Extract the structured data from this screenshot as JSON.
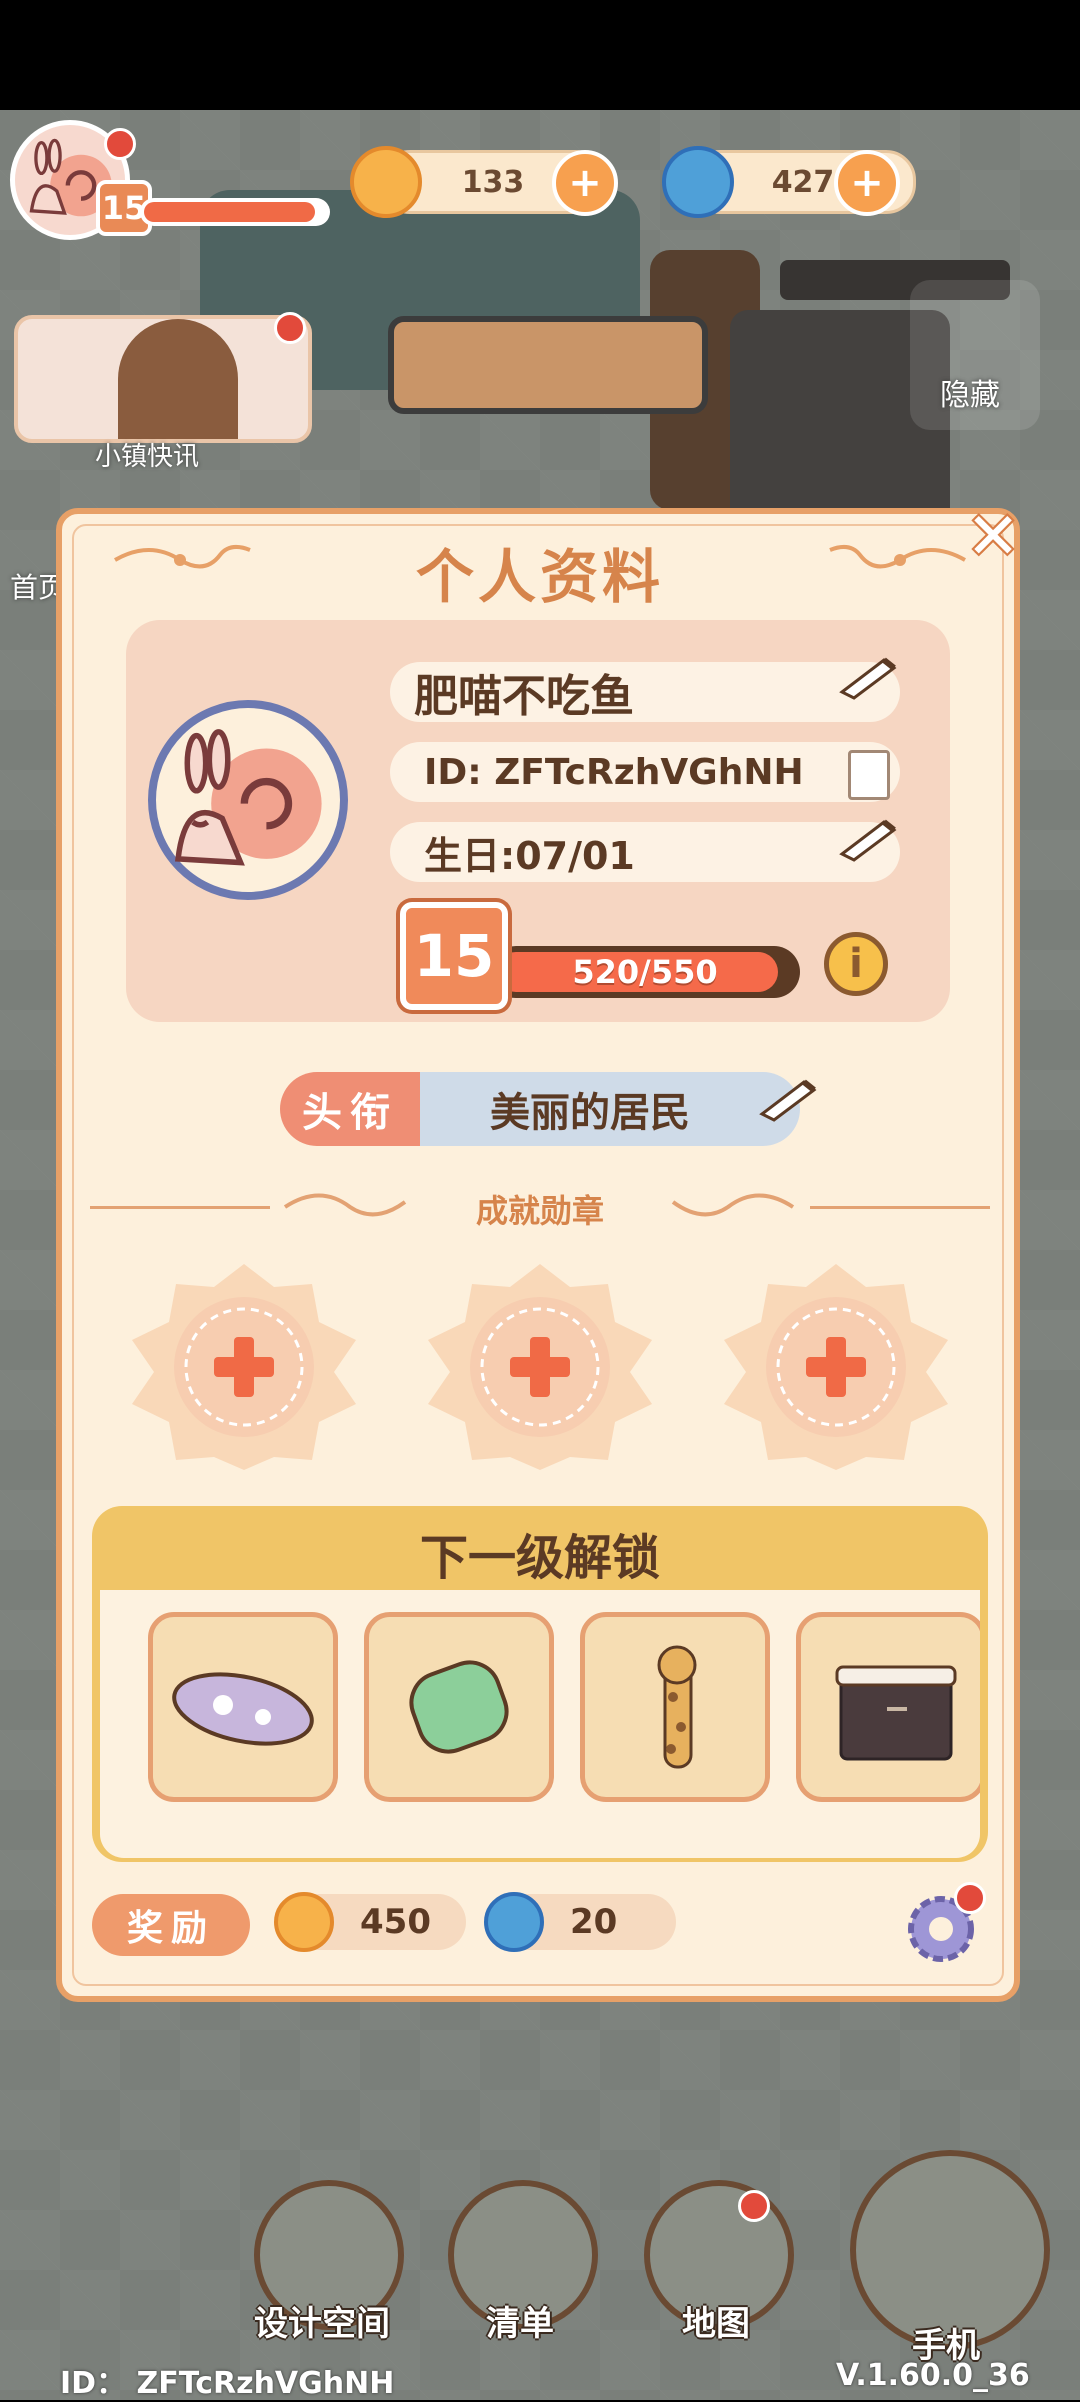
{
  "hud": {
    "player_level": "15",
    "coins": "133",
    "gems": "427",
    "news_label": "小镇快讯",
    "hide_label": "隐藏",
    "side_label": "首页"
  },
  "profile": {
    "title": "个人资料",
    "name": "肥喵不吃鱼",
    "id": "ID: ZFTcRzhVGhNH",
    "birthday": "生日:07/01",
    "level": "15",
    "xp_text": "520/550",
    "xp_progress": 0.945,
    "title_tag": "头衔",
    "title_value": "美丽的居民",
    "achievements_label": "成就勋章",
    "unlock_title": "下一级解锁",
    "unlock_items": [
      "sleeping-mat-icon",
      "green-cushion-icon",
      "giraffe-decor-icon",
      "cabinet-icon"
    ],
    "reward_label": "奖励",
    "reward_coins": "450",
    "reward_gems": "20"
  },
  "nav": {
    "design": "设计空间",
    "list": "清单",
    "map": "地图",
    "phone": "手机"
  },
  "footer": {
    "id": "ID： ZFTcRzhVGhNH",
    "version": "V.1.60.0_36"
  },
  "colors": {
    "panel_bg": "#fdf0dc",
    "panel_border": "#e7a067",
    "accent_orange": "#d6844b",
    "unlock_gold": "#f0c567",
    "xp_red": "#f56a4a"
  }
}
